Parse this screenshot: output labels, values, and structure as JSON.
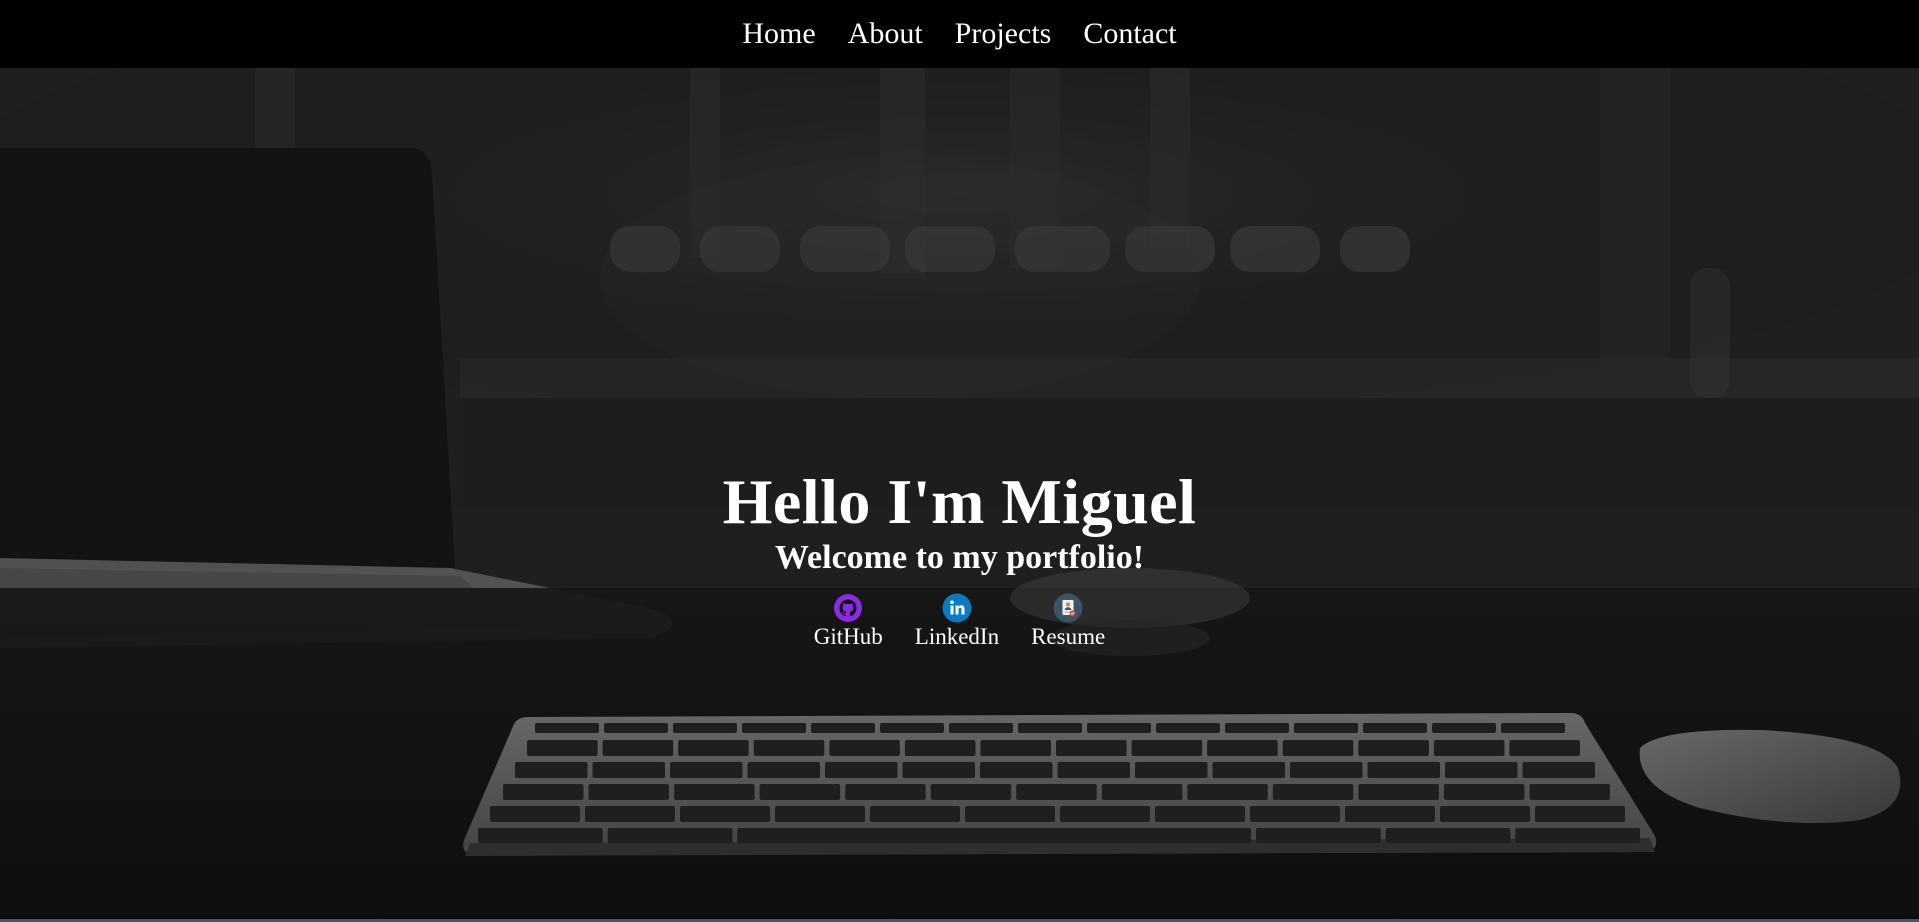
{
  "nav": {
    "items": [
      {
        "label": "Home"
      },
      {
        "label": "About"
      },
      {
        "label": "Projects"
      },
      {
        "label": "Contact"
      }
    ]
  },
  "hero": {
    "title": "Hello I'm Miguel",
    "subtitle": "Welcome to my portfolio!",
    "links": [
      {
        "label": "GitHub",
        "icon": "github-icon",
        "color": "#8a2be2"
      },
      {
        "label": "LinkedIn",
        "icon": "linkedin-icon",
        "color": "#0a7bc1"
      },
      {
        "label": "Resume",
        "icon": "resume-icon",
        "color": "#3b5566"
      }
    ]
  },
  "colors": {
    "navbar_bg": "#000000",
    "text": "#ffffff",
    "bottom_accent": "#3a5a66"
  }
}
